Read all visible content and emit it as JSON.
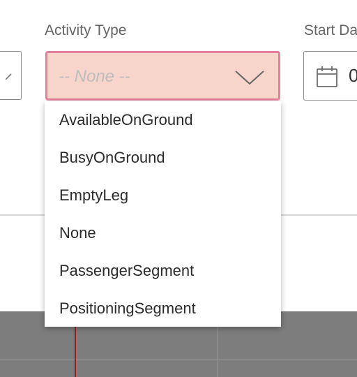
{
  "form": {
    "activity_type_label": "Activity Type",
    "start_date_label": "Start Da",
    "activity_select": {
      "placeholder": "-- None --",
      "state": "invalid",
      "fill_color": "#f8d5cb",
      "border_color": "#e3839b"
    },
    "start_date_value": "0"
  },
  "dropdown": {
    "options": [
      "AvailableOnGround",
      "BusyOnGround",
      "EmptyLeg",
      "None",
      "PassengerSegment",
      "PositioningSegment"
    ]
  },
  "icons": {
    "activity_chevron": "chevron-down-icon",
    "date_icon": "calendar-icon",
    "left_chevron": "chevron-down-icon"
  },
  "colors": {
    "timeline_background": "#7d7d7d",
    "time_marker": "#9e1b1b"
  }
}
